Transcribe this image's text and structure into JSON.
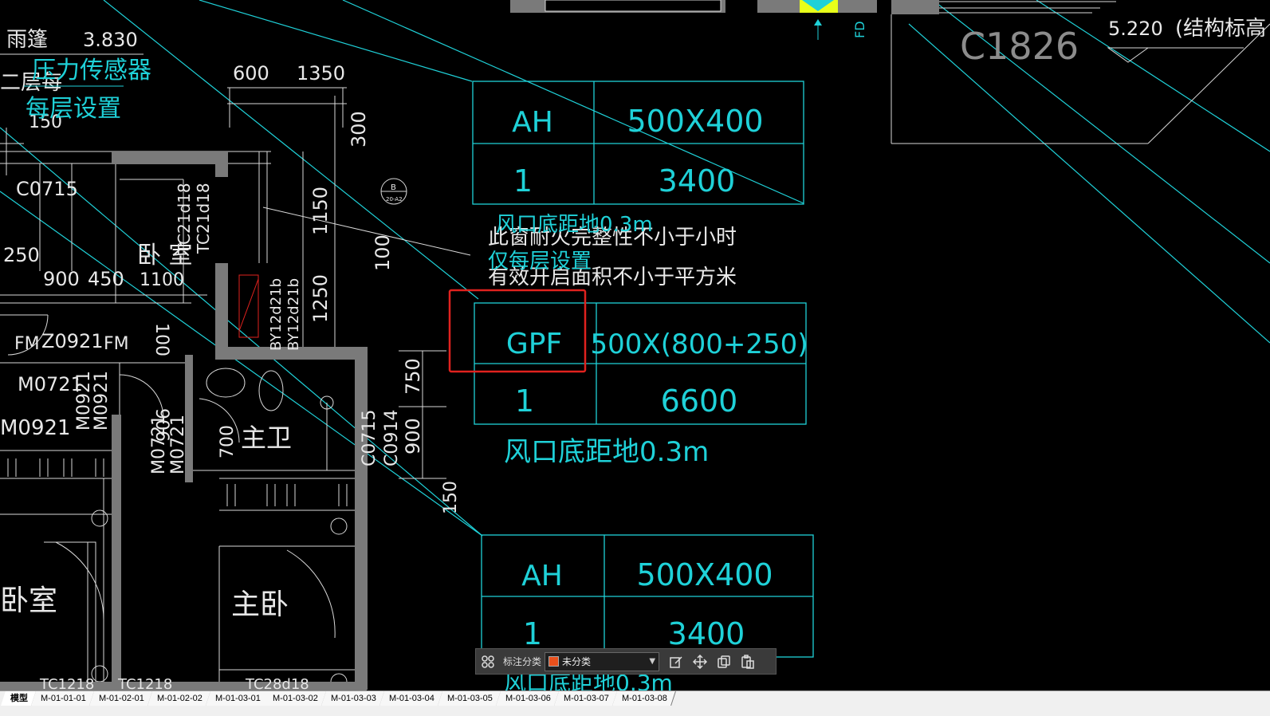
{
  "drawing": {
    "texts_white": {
      "canopy": "雨篷",
      "canopy_elev": "3.830",
      "floor_note": "二层每",
      "dim_600": "600",
      "dim_1350": "1350",
      "dim_150": "150",
      "dim_250": "250",
      "dim_900": "900",
      "dim_450": "450",
      "dim_1100": "1100",
      "dim_300": "300",
      "dim_1150": "1150",
      "dim_100": "100",
      "dim_1250": "1250",
      "dim_750": "750",
      "dim_900b": "900",
      "dim_700": "700",
      "dim_150b": "150",
      "dim_906": "906",
      "dim_100b": "100",
      "c0715": "C0715",
      "tc21": "TC21d18",
      "tc21b": "TC21d18",
      "bedroom": "卧 室",
      "fm": "FM",
      "z0921": "Z0921",
      "fm2": "FM",
      "m0721": "M0721",
      "m0921a": "M0921",
      "m0921b": "M0921",
      "m0921c": "M0921",
      "m0721b": "M0721",
      "m0721c": "M0721",
      "c0715b": "C0715",
      "c0914": "C0914",
      "main_bath": "主卫",
      "bedroom2": "卧室",
      "master_bed": "主卧",
      "bay": "BY12d21b",
      "bay2": "BY12d21b",
      "tc1218a": "TC1218",
      "tc1218b": "TC1218",
      "tc28": "TC28d18",
      "c1826": "C1826",
      "elev_5220": "5.220",
      "struct_note": "(结构标高",
      "fire_note_1": "此窗耐火完整性不小于小时",
      "fire_note_2": "有效开启面积不小于平方米",
      "axis_b": "B",
      "axis_b_sub": "20-A2"
    },
    "texts_cyan": {
      "sensor": "压力传感器",
      "each_floor": "每层设置",
      "each_floor2": "仅每层设置",
      "outlet_note_a": "风口底距地0.3m",
      "outlet_note_b": "风口底距地0.3m",
      "outlet_note_c": "风口底距地0.3m",
      "fd": "FD"
    },
    "tables": [
      {
        "id": "ah-1",
        "code": "AH",
        "size": "500X400",
        "qty": "1",
        "flow": "3400"
      },
      {
        "id": "gpf",
        "code": "GPF",
        "size": "500X(800+250)",
        "qty": "1",
        "flow": "6600"
      },
      {
        "id": "ah-2",
        "code": "AH",
        "size": "500X400",
        "qty": "1",
        "flow": "3400"
      }
    ]
  },
  "toolbar": {
    "label": "标注分类",
    "category_value": "未分类",
    "category_color": "#e8501c",
    "icons": [
      "grid-icon",
      "edit-icon",
      "move-icon",
      "copy-icon",
      "paste-icon"
    ]
  },
  "sheet_tabs": {
    "active": "模型",
    "tabs": [
      "模型",
      "M-01-01-01",
      "M-01-02-01",
      "M-01-02-02",
      "M-01-03-01",
      "M-01-03-02",
      "M-01-03-03",
      "M-01-03-04",
      "M-01-03-05",
      "M-01-03-06",
      "M-01-03-07",
      "M-01-03-08"
    ]
  },
  "colors": {
    "background": "#000000",
    "lines": "#d9d9d9",
    "cyan": "#1fd1d8",
    "wall_gray": "#7a7a7a",
    "highlight_red": "#e0221e"
  }
}
